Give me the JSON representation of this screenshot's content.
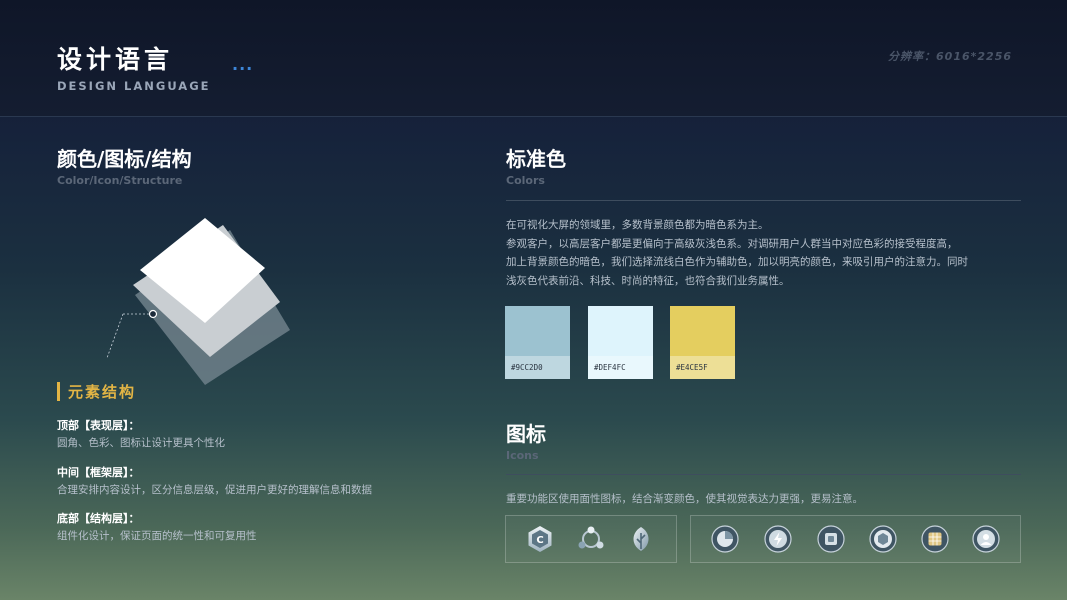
{
  "header": {
    "title": "设计语言",
    "subtitle": "DESIGN LANGUAGE",
    "dots": "...",
    "right_text": "分辨率：6016*2256"
  },
  "left": {
    "title": "颜色/图标/结构",
    "subtitle": "Color/Icon/Structure",
    "elements": {
      "title": "元素结构",
      "items": [
        {
          "head": "顶部【表现层】：",
          "desc": "圆角、色彩、图标让设计更具个性化"
        },
        {
          "head": "中间【框架层】：",
          "desc": "合理安排内容设计，区分信息层级，促进用户更好的理解信息和数据"
        },
        {
          "head": "底部【结构层】：",
          "desc": "组件化设计，保证页面的统一性和可复用性"
        }
      ]
    }
  },
  "colors": {
    "title": "标准色",
    "subtitle": "Colors",
    "paragraph": [
      "在可视化大屏的领域里，多数背景颜色都为暗色系为主。",
      "参观客户，以高层客户都是更偏向于高级灰浅色系。对调研用户人群当中对应色彩的接受程度高，",
      "加上背景颜色的暗色，我们选择流线白色作为辅助色，加以明亮的颜色，来吸引用户的注意力。同时",
      "浅灰色代表前沿、科技、时尚的特征，也符合我们业务属性。"
    ],
    "swatches": [
      {
        "hex": "#9CC2D0",
        "color": "#9CC2D0"
      },
      {
        "hex": "#DEF4FC",
        "color": "#DEF4FC"
      },
      {
        "hex": "#E4CE5F",
        "color": "#E4CE5F"
      }
    ]
  },
  "icons": {
    "title": "图标",
    "subtitle": "Icons",
    "description": "重要功能区使用面性图标，结合渐变颜色，使其视觉表达力更强，更易注意。",
    "group1": [
      "hexagon-c-icon",
      "share-nodes-icon",
      "leaf-icon"
    ],
    "group2": [
      "pie-chart-icon",
      "lightning-icon",
      "document-icon",
      "cube-icon",
      "grid-icon",
      "user-icon"
    ]
  },
  "palette": {
    "accent_blue": "#3d86d8",
    "accent_gold": "#e3b545"
  }
}
